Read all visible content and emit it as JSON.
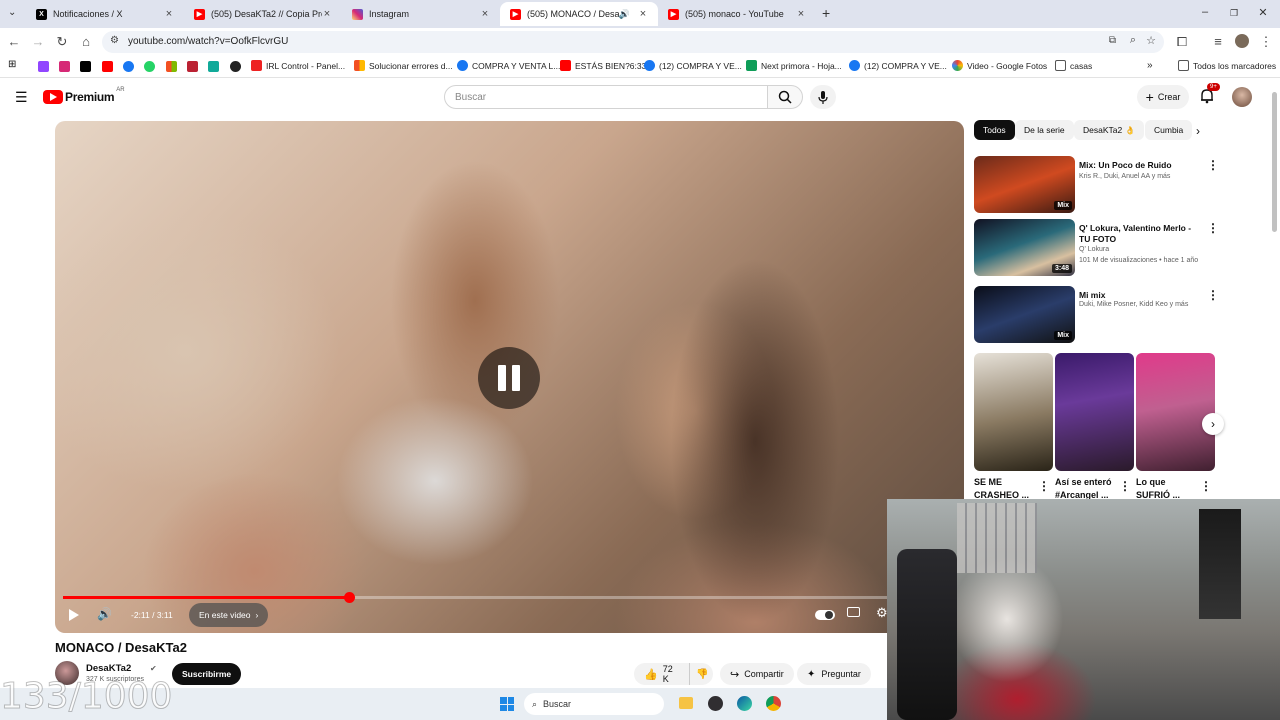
{
  "browser": {
    "tabs": [
      {
        "title": "Notificaciones / X",
        "icon": "x-logo-icon",
        "color": "#000000"
      },
      {
        "title": "(505) DesaKTa2 // Copia Prohibi",
        "icon": "youtube-logo-icon",
        "color": "#ff0000"
      },
      {
        "title": "Instagram",
        "icon": "instagram-logo-icon",
        "color": "#d62976"
      },
      {
        "title": "(505) MONACO / DesaKTa2",
        "icon": "youtube-logo-icon",
        "color": "#ff0000",
        "active": true
      },
      {
        "title": "(505) monaco - YouTube",
        "icon": "youtube-logo-icon",
        "color": "#ff0000"
      }
    ],
    "url": "youtube.com/watch?v=OofkFlcvrGU",
    "bookmarks": [
      {
        "label": "IRL Control - Panel..."
      },
      {
        "label": "Solucionar errores d..."
      },
      {
        "label": "COMPRA Y VENTA L..."
      },
      {
        "label": "ESTÁS BIEN?6:33"
      },
      {
        "label": "(12) COMPRA Y VE..."
      },
      {
        "label": "Next primora - Hoja..."
      },
      {
        "label": "(12) COMPRA Y VE..."
      },
      {
        "label": "Video - Google Fotos"
      },
      {
        "label": "casas"
      }
    ],
    "all_bookmarks": "Todos los marcadores"
  },
  "youtube": {
    "logo": "Premium",
    "region": "AR",
    "search_placeholder": "Buscar",
    "create_label": "Crear",
    "notif_count": "9+",
    "player": {
      "time": "-2:11 / 3:11",
      "chapters_label": "En este video",
      "progress": 0.32
    },
    "video_title": "MONACO / DesaKTa2",
    "channel_name": "DesaKTa2",
    "subscribers": "327 K suscriptores",
    "subscribe_label": "Suscribirme",
    "likes": "72 K",
    "share_label": "Compartir",
    "ask_label": "Preguntar",
    "chips": [
      "Todos",
      "De la serie",
      "DesaKTa2",
      "Cumbia"
    ],
    "recs": [
      {
        "title": "Mix: Un Poco de Ruido",
        "meta": "Kris R., Duki, Anuel AA y más",
        "badge": "Mix"
      },
      {
        "title": "Q' Lokura, Valentino Merlo - TU FOTO",
        "channel": "Q' Lokura",
        "meta": "101 M de visualizaciones • hace 1 año",
        "badge": "3:48"
      },
      {
        "title": "Mi mix",
        "meta": "Duki, Mike Posner, Kidd Keo y más",
        "badge": "Mix"
      }
    ],
    "shorts": [
      {
        "title": "SE ME CRASHEO ..."
      },
      {
        "title": "Así se enteró #Arcangel ..."
      },
      {
        "title": "Lo que SUFRIÓ ..."
      }
    ]
  },
  "taskbar": {
    "search_label": "Buscar"
  },
  "overlay_counter": "133/1000"
}
